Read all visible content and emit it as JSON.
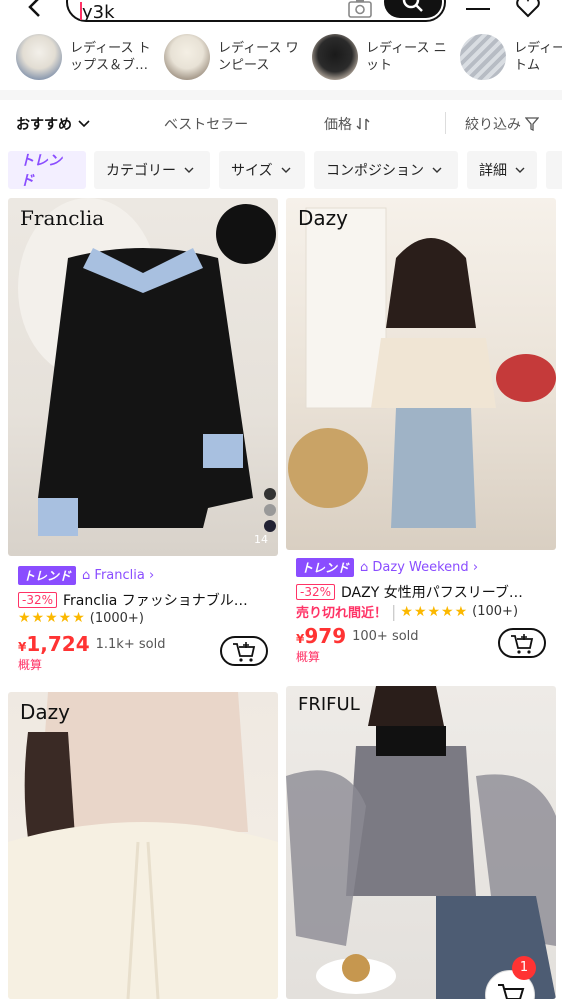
{
  "search": {
    "query": "y3k"
  },
  "categories": [
    {
      "label": "レディース ト\nップス＆ブ…"
    },
    {
      "label": "レディース ワ\nンピース"
    },
    {
      "label": "レディース ニ\nット"
    },
    {
      "label": "レディー\nトム"
    }
  ],
  "sortbar": {
    "recommended": "おすすめ",
    "bestseller": "ベストセラー",
    "price": "価格",
    "filter": "絞り込み"
  },
  "filters": {
    "trend": "トレンド",
    "category": "カテゴリー",
    "size": "サイズ",
    "composition": "コンポジション",
    "detail": "詳細"
  },
  "products": [
    {
      "brand_watermark": "Franclia",
      "trend_badge": "トレンド",
      "store": "Franclia",
      "discount": "-32%",
      "title": "Franclia ファッショナブル…",
      "reviews": "(1000+)",
      "price_symbol": "¥",
      "price": "1,724",
      "sold": "1.1k+ sold",
      "estimate": "概算",
      "color_count": "14"
    },
    {
      "brand_watermark": "Dazy",
      "trend_badge": "トレンド",
      "store": "Dazy Weekend",
      "discount": "-32%",
      "title": "DAZY 女性用パフスリーブ…",
      "sellout": "売り切れ間近！",
      "reviews": "(100+)",
      "price_symbol": "¥",
      "price": "979",
      "sold": "100+ sold",
      "estimate": "概算"
    },
    {
      "brand_watermark": "Dazy"
    },
    {
      "brand_watermark": "FRIFUL"
    }
  ],
  "cart_badge": "1",
  "colors": {
    "accent_purple": "#8a4dff",
    "price_red": "#f33",
    "star": "#fbb800"
  }
}
